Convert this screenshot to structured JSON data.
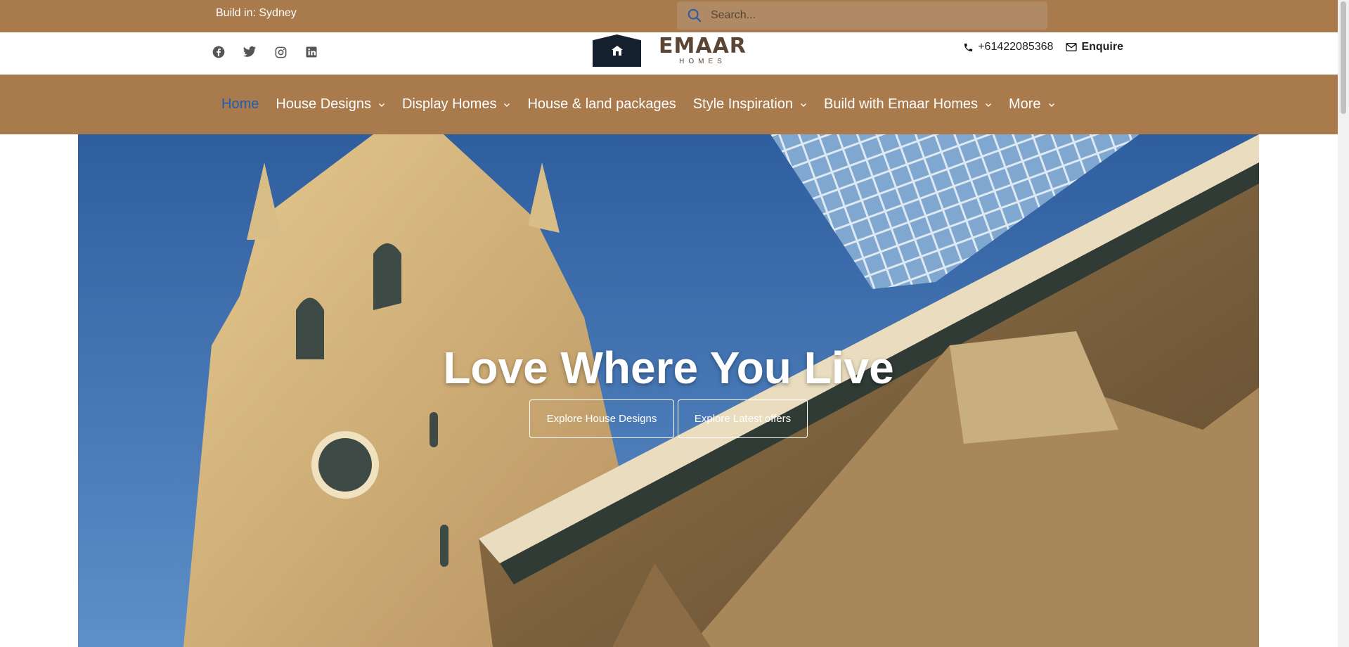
{
  "topbar": {
    "build_in": "Build in: Sydney",
    "search_placeholder": "Search...",
    "background": "#a97a4b"
  },
  "header": {
    "social_icons": [
      "facebook-icon",
      "twitter-icon",
      "instagram-icon",
      "linkedin-icon"
    ],
    "logo_word": "EMAAR",
    "logo_sub": "HOMES",
    "phone": "+61422085368",
    "enquire": "Enquire"
  },
  "nav": {
    "items": [
      {
        "label": "Home",
        "active": true,
        "dropdown": false
      },
      {
        "label": "House Designs",
        "active": false,
        "dropdown": true
      },
      {
        "label": "Display Homes",
        "active": false,
        "dropdown": true
      },
      {
        "label": "House & land packages",
        "active": false,
        "dropdown": false
      },
      {
        "label": "Style Inspiration",
        "active": false,
        "dropdown": true
      },
      {
        "label": "Build with Emaar Homes",
        "active": false,
        "dropdown": true
      },
      {
        "label": "More",
        "active": false,
        "dropdown": true
      }
    ],
    "active_color": "#1e5fb3"
  },
  "hero": {
    "title": "Love Where You Live",
    "buttons": [
      "Explore House Designs",
      "Explore Latest offers"
    ]
  }
}
